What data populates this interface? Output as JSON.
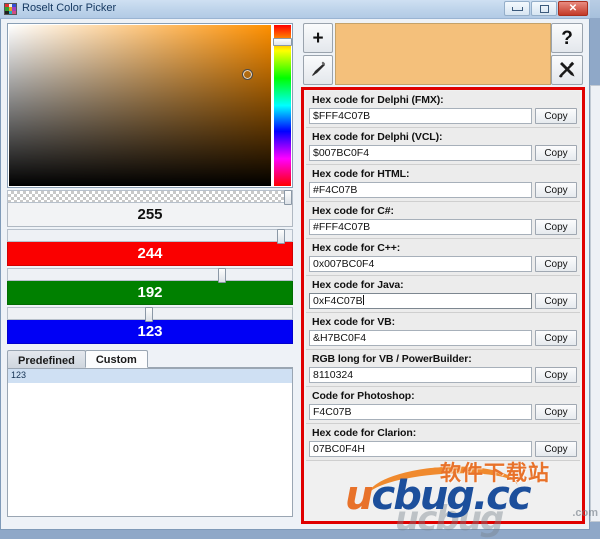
{
  "window": {
    "title": "Roselt Color Picker",
    "icon": "color-palette-icon",
    "minimize_label": "Minimize",
    "maximize_label": "Maximize",
    "close_label": "Close"
  },
  "picker": {
    "hue_strip_name": "hue-strip",
    "cursor_name": "saturation-value-cursor",
    "selected_hex": "#F4C07B"
  },
  "sliders": [
    {
      "name": "alpha",
      "value": "255",
      "thumb_pct": 100
    },
    {
      "name": "red",
      "value": "244",
      "thumb_pct": 95.7
    },
    {
      "name": "green",
      "value": "192",
      "thumb_pct": 75.3
    },
    {
      "name": "blue",
      "value": "123",
      "thumb_pct": 48.2
    }
  ],
  "tabs": {
    "predefined": "Predefined",
    "custom": "Custom",
    "active": "Custom"
  },
  "list": {
    "items": [
      "123"
    ]
  },
  "toolbar": {
    "add_label": "+",
    "eyedropper_label": "eyedropper",
    "help_label": "?",
    "tools_label": "tools"
  },
  "codes": [
    {
      "label": "Hex code for Delphi (FMX):",
      "value": "$FFF4C07B",
      "copy": "Copy",
      "focused": false
    },
    {
      "label": "Hex code for Delphi (VCL):",
      "value": "$007BC0F4",
      "copy": "Copy",
      "focused": false
    },
    {
      "label": "Hex code for HTML:",
      "value": "#F4C07B",
      "copy": "Copy",
      "focused": false
    },
    {
      "label": "Hex code for C#:",
      "value": "#FFF4C07B",
      "copy": "Copy",
      "focused": false
    },
    {
      "label": "Hex code for C++:",
      "value": "0x007BC0F4",
      "copy": "Copy",
      "focused": false
    },
    {
      "label": "Hex code for Java:",
      "value": "0xF4C07B",
      "copy": "Copy",
      "focused": true
    },
    {
      "label": "Hex code for VB:",
      "value": "&H7BC0F4",
      "copy": "Copy",
      "focused": false
    },
    {
      "label": "RGB long for VB / PowerBuilder:",
      "value": "8110324",
      "copy": "Copy",
      "focused": false
    },
    {
      "label": "Code for Photoshop:",
      "value": "F4C07B",
      "copy": "Copy",
      "focused": false
    },
    {
      "label": "Hex code for Clarion:",
      "value": "07BC0F4H",
      "copy": "Copy",
      "focused": false
    }
  ],
  "watermark": {
    "chinese": "软件下载站",
    "brand_u": "u",
    "brand_rest": "cbug",
    "brand_tld": ".cc",
    "ghost": "ucbug",
    "com": ".com"
  },
  "colors": {
    "preview": "#F4C07B",
    "red_bar": "#FA0000",
    "green_bar": "#008000",
    "blue_bar": "#0000F5",
    "frame_red": "#E00000"
  }
}
